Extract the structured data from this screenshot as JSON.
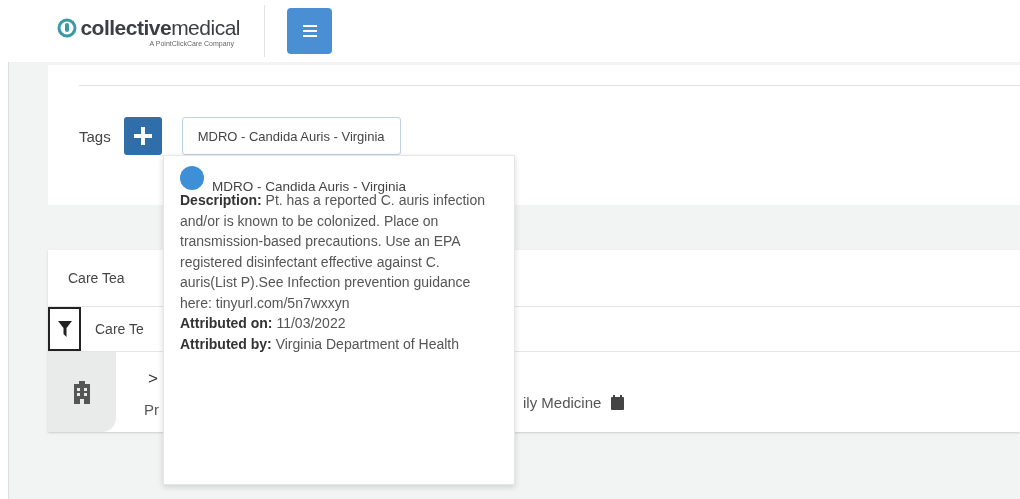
{
  "header": {
    "logo": "**collective**medical",
    "tagline": "A PointClickCare Company"
  },
  "tags_section": {
    "label": "Tags",
    "tags": [
      {
        "label": "MDRO - Candida Auris - Virginia"
      }
    ]
  },
  "care_team": {
    "tab": "Care Tea",
    "filter_label": "Care Te",
    "row": {
      "expander": ">",
      "subtitle": "Pr",
      "specialty": "ily Medicine"
    }
  },
  "tooltip": {
    "title": "MDRO - Candida Auris - Virginia",
    "color": "#3d8fd6",
    "lines": [
      "**Description:** Pt. has a reported C. auris infection and/or is known to be colonized. Place on transmission-based precautions. Use an EPA registered disinfectant effective against C. auris(List P).See Infection prevention guidance here: tinyurl.com/5n7wxxyn",
      "**Attributed on:** 11/03/2022",
      "**Attributed by:** Virginia Department of Health"
    ]
  }
}
